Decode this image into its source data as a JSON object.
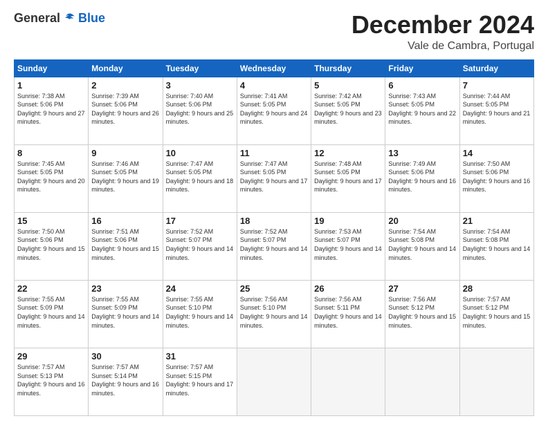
{
  "logo": {
    "general": "General",
    "blue": "Blue"
  },
  "header": {
    "month": "December 2024",
    "location": "Vale de Cambra, Portugal"
  },
  "weekdays": [
    "Sunday",
    "Monday",
    "Tuesday",
    "Wednesday",
    "Thursday",
    "Friday",
    "Saturday"
  ],
  "weeks": [
    [
      {
        "day": "1",
        "sunrise": "7:38 AM",
        "sunset": "5:06 PM",
        "daylight": "9 hours and 27 minutes."
      },
      {
        "day": "2",
        "sunrise": "7:39 AM",
        "sunset": "5:06 PM",
        "daylight": "9 hours and 26 minutes."
      },
      {
        "day": "3",
        "sunrise": "7:40 AM",
        "sunset": "5:06 PM",
        "daylight": "9 hours and 25 minutes."
      },
      {
        "day": "4",
        "sunrise": "7:41 AM",
        "sunset": "5:05 PM",
        "daylight": "9 hours and 24 minutes."
      },
      {
        "day": "5",
        "sunrise": "7:42 AM",
        "sunset": "5:05 PM",
        "daylight": "9 hours and 23 minutes."
      },
      {
        "day": "6",
        "sunrise": "7:43 AM",
        "sunset": "5:05 PM",
        "daylight": "9 hours and 22 minutes."
      },
      {
        "day": "7",
        "sunrise": "7:44 AM",
        "sunset": "5:05 PM",
        "daylight": "9 hours and 21 minutes."
      }
    ],
    [
      {
        "day": "8",
        "sunrise": "7:45 AM",
        "sunset": "5:05 PM",
        "daylight": "9 hours and 20 minutes."
      },
      {
        "day": "9",
        "sunrise": "7:46 AM",
        "sunset": "5:05 PM",
        "daylight": "9 hours and 19 minutes."
      },
      {
        "day": "10",
        "sunrise": "7:47 AM",
        "sunset": "5:05 PM",
        "daylight": "9 hours and 18 minutes."
      },
      {
        "day": "11",
        "sunrise": "7:47 AM",
        "sunset": "5:05 PM",
        "daylight": "9 hours and 17 minutes."
      },
      {
        "day": "12",
        "sunrise": "7:48 AM",
        "sunset": "5:05 PM",
        "daylight": "9 hours and 17 minutes."
      },
      {
        "day": "13",
        "sunrise": "7:49 AM",
        "sunset": "5:06 PM",
        "daylight": "9 hours and 16 minutes."
      },
      {
        "day": "14",
        "sunrise": "7:50 AM",
        "sunset": "5:06 PM",
        "daylight": "9 hours and 16 minutes."
      }
    ],
    [
      {
        "day": "15",
        "sunrise": "7:50 AM",
        "sunset": "5:06 PM",
        "daylight": "9 hours and 15 minutes."
      },
      {
        "day": "16",
        "sunrise": "7:51 AM",
        "sunset": "5:06 PM",
        "daylight": "9 hours and 15 minutes."
      },
      {
        "day": "17",
        "sunrise": "7:52 AM",
        "sunset": "5:07 PM",
        "daylight": "9 hours and 14 minutes."
      },
      {
        "day": "18",
        "sunrise": "7:52 AM",
        "sunset": "5:07 PM",
        "daylight": "9 hours and 14 minutes."
      },
      {
        "day": "19",
        "sunrise": "7:53 AM",
        "sunset": "5:07 PM",
        "daylight": "9 hours and 14 minutes."
      },
      {
        "day": "20",
        "sunrise": "7:54 AM",
        "sunset": "5:08 PM",
        "daylight": "9 hours and 14 minutes."
      },
      {
        "day": "21",
        "sunrise": "7:54 AM",
        "sunset": "5:08 PM",
        "daylight": "9 hours and 14 minutes."
      }
    ],
    [
      {
        "day": "22",
        "sunrise": "7:55 AM",
        "sunset": "5:09 PM",
        "daylight": "9 hours and 14 minutes."
      },
      {
        "day": "23",
        "sunrise": "7:55 AM",
        "sunset": "5:09 PM",
        "daylight": "9 hours and 14 minutes."
      },
      {
        "day": "24",
        "sunrise": "7:55 AM",
        "sunset": "5:10 PM",
        "daylight": "9 hours and 14 minutes."
      },
      {
        "day": "25",
        "sunrise": "7:56 AM",
        "sunset": "5:10 PM",
        "daylight": "9 hours and 14 minutes."
      },
      {
        "day": "26",
        "sunrise": "7:56 AM",
        "sunset": "5:11 PM",
        "daylight": "9 hours and 14 minutes."
      },
      {
        "day": "27",
        "sunrise": "7:56 AM",
        "sunset": "5:12 PM",
        "daylight": "9 hours and 15 minutes."
      },
      {
        "day": "28",
        "sunrise": "7:57 AM",
        "sunset": "5:12 PM",
        "daylight": "9 hours and 15 minutes."
      }
    ],
    [
      {
        "day": "29",
        "sunrise": "7:57 AM",
        "sunset": "5:13 PM",
        "daylight": "9 hours and 16 minutes."
      },
      {
        "day": "30",
        "sunrise": "7:57 AM",
        "sunset": "5:14 PM",
        "daylight": "9 hours and 16 minutes."
      },
      {
        "day": "31",
        "sunrise": "7:57 AM",
        "sunset": "5:15 PM",
        "daylight": "9 hours and 17 minutes."
      },
      null,
      null,
      null,
      null
    ]
  ]
}
